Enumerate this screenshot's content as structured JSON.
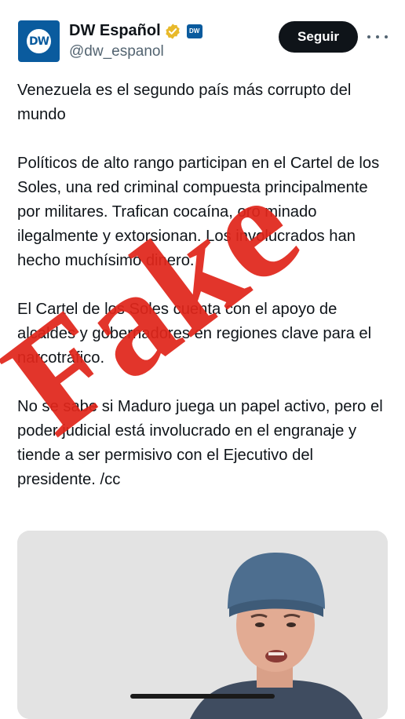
{
  "account": {
    "display_name": "DW Español",
    "handle": "@dw_espanol",
    "avatar_text": "DW",
    "affiliate_badge_text": "DW",
    "follow_label": "Seguir"
  },
  "tweet": {
    "paragraphs": [
      "Venezuela es el segundo país más corrupto del mundo",
      "Políticos de alto rango participan en el Cartel de los Soles, una red criminal compuesta principalmente por militares. Trafican cocaína, oro minado ilegalmente y extorsionan. Los involucrados han hecho muchísimo dinero.",
      "El Cartel de los Soles cuenta con el apoyo de alcaldes y gobernadores en regiones clave para el narcotráfico.",
      "No se sabe si Maduro juega un papel activo, pero el poder judicial está involucrado en el engranaje y tiende a ser permisivo con el Ejecutivo del presidente. /cc"
    ]
  },
  "overlay": {
    "stamp_text": "Fake",
    "stamp_color": "#e0261b"
  },
  "colors": {
    "brand": "#0a5b9e",
    "verified": "#e8b92b",
    "text": "#0f1419",
    "muted": "#536471"
  },
  "icons": {
    "verified": "verified-badge-icon",
    "more": "more-options-icon"
  }
}
